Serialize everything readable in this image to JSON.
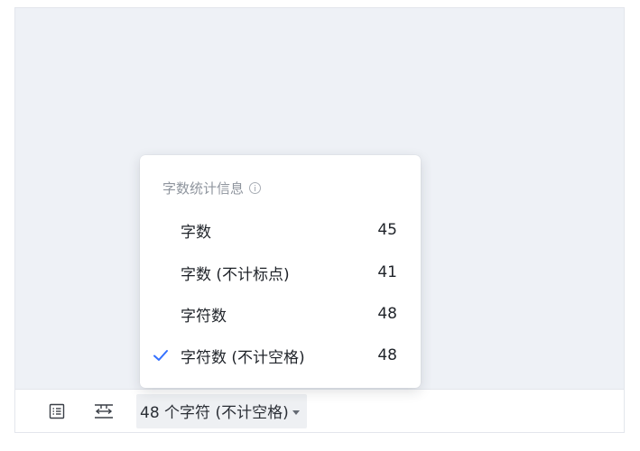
{
  "statusbar": {
    "outline_icon": "list-outline-icon",
    "page_width_icon": "page-width-icon",
    "count_label": "48 个字符 (不计空格)"
  },
  "word_count_popover": {
    "title": "字数统计信息",
    "info_icon": "info-circle-icon",
    "accent_color": "#3370ff",
    "options": [
      {
        "label": "字数",
        "value": "45",
        "selected": false
      },
      {
        "label": "字数 (不计标点)",
        "value": "41",
        "selected": false
      },
      {
        "label": "字符数",
        "value": "48",
        "selected": false
      },
      {
        "label": "字符数 (不计空格)",
        "value": "48",
        "selected": true
      }
    ]
  }
}
